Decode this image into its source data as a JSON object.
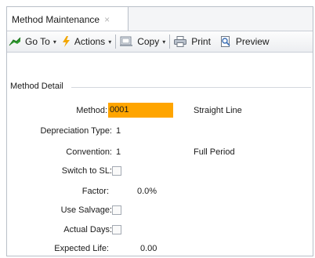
{
  "tab": {
    "title": "Method Maintenance",
    "close": "×"
  },
  "toolbar": {
    "goto_label": "Go To",
    "actions_label": "Actions",
    "copy_label": "Copy",
    "print_label": "Print",
    "preview_label": "Preview",
    "caret": "▾"
  },
  "group": {
    "title": "Method Detail"
  },
  "form": {
    "method_label": "Method:",
    "method_value": "0001",
    "method_description": "Straight Line",
    "dep_type_label": "Depreciation Type:",
    "dep_type_value": "1",
    "convention_label": "Convention:",
    "convention_value": "1",
    "convention_description": "Full Period",
    "switch_sl_label": "Switch to SL:",
    "switch_sl_checked": false,
    "factor_label": "Factor:",
    "factor_value": "0.0%",
    "use_salvage_label": "Use Salvage:",
    "use_salvage_checked": false,
    "actual_days_label": "Actual Days:",
    "actual_days_checked": false,
    "expected_life_label": "Expected Life:",
    "expected_life_value": "0.00"
  },
  "colors": {
    "method_highlight": "#ffa500",
    "goto_icon": "#2e9a2e",
    "actions_icon": "#f2a600"
  }
}
